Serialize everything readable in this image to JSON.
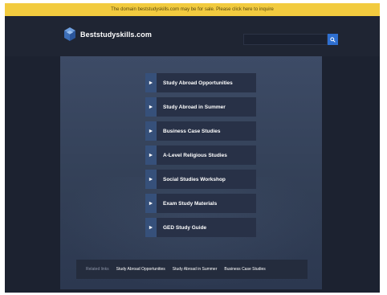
{
  "banner": {
    "text": "The domain beststudyskills.com may be for sale. Please click here to inquire"
  },
  "header": {
    "logo_icon": "stacked-cube-logo",
    "logo_text": "Beststudyskills.com",
    "search": {
      "placeholder": "",
      "value": "",
      "icon": "search-icon"
    }
  },
  "colors": {
    "banner_bg": "#f2cb3f",
    "header_bg": "#1f2533",
    "panel_bg": "#3d4b66",
    "menu_item_bg": "#283147",
    "menu_arrow_bg": "#36507a",
    "search_button": "#2e6fd0"
  },
  "menu": {
    "items": [
      {
        "label": "Study Abroad Opportunities",
        "icon": "arrow-right-icon"
      },
      {
        "label": "Study Abroad in Summer",
        "icon": "arrow-right-icon"
      },
      {
        "label": "Business Case Studies",
        "icon": "arrow-right-icon"
      },
      {
        "label": "A-Level Religious Studies",
        "icon": "arrow-right-icon"
      },
      {
        "label": "Social Studies Workshop",
        "icon": "arrow-right-icon"
      },
      {
        "label": "Exam Study Materials",
        "icon": "arrow-right-icon"
      },
      {
        "label": "GED Study Guide",
        "icon": "arrow-right-icon"
      }
    ]
  },
  "related": {
    "label": "Related links",
    "links": [
      "Study Abroad Opportunities",
      "Study Abroad in Summer",
      "Business Case Studies"
    ]
  }
}
